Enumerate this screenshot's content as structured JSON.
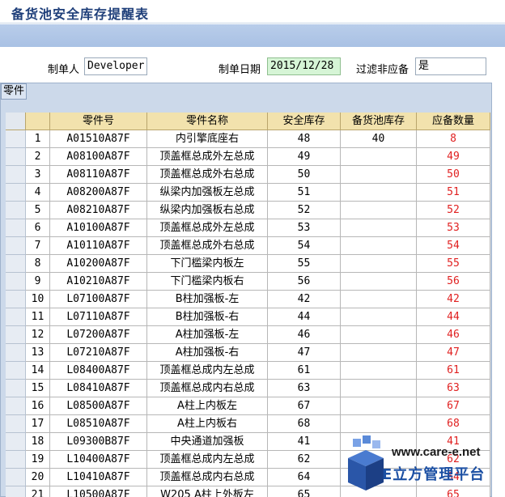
{
  "window": {
    "title": "备货池安全库存提醒表"
  },
  "filters": {
    "maker_label": "制单人",
    "maker_value": "Developer",
    "date_label": "制单日期",
    "date_value": "2015/12/28",
    "filter_label": "过滤非应备",
    "filter_value": "是"
  },
  "panel": {
    "tag": "零件"
  },
  "table": {
    "headers": [
      "零件号",
      "零件名称",
      "安全库存",
      "备货池库存",
      "应备数量"
    ],
    "rows": [
      {
        "no": "1",
        "part": "A01510A87F",
        "name": "内引擎底座右",
        "safe": "48",
        "pool": "40",
        "need": "8"
      },
      {
        "no": "2",
        "part": "A08100A87F",
        "name": "顶盖框总成外左总成",
        "safe": "49",
        "pool": "",
        "need": "49"
      },
      {
        "no": "3",
        "part": "A08110A87F",
        "name": "顶盖框总成外右总成",
        "safe": "50",
        "pool": "",
        "need": "50"
      },
      {
        "no": "4",
        "part": "A08200A87F",
        "name": "纵梁内加强板左总成",
        "safe": "51",
        "pool": "",
        "need": "51"
      },
      {
        "no": "5",
        "part": "A08210A87F",
        "name": "纵梁内加强板右总成",
        "safe": "52",
        "pool": "",
        "need": "52"
      },
      {
        "no": "6",
        "part": "A10100A87F",
        "name": "顶盖框总成外左总成",
        "safe": "53",
        "pool": "",
        "need": "53"
      },
      {
        "no": "7",
        "part": "A10110A87F",
        "name": "顶盖框总成外右总成",
        "safe": "54",
        "pool": "",
        "need": "54"
      },
      {
        "no": "8",
        "part": "A10200A87F",
        "name": "下门槛梁内板左",
        "safe": "55",
        "pool": "",
        "need": "55"
      },
      {
        "no": "9",
        "part": "A10210A87F",
        "name": "下门槛梁内板右",
        "safe": "56",
        "pool": "",
        "need": "56"
      },
      {
        "no": "10",
        "part": "L07100A87F",
        "name": "B柱加强板-左",
        "safe": "42",
        "pool": "",
        "need": "42"
      },
      {
        "no": "11",
        "part": "L07110A87F",
        "name": "B柱加强板-右",
        "safe": "44",
        "pool": "",
        "need": "44"
      },
      {
        "no": "12",
        "part": "L07200A87F",
        "name": "A柱加强板-左",
        "safe": "46",
        "pool": "",
        "need": "46"
      },
      {
        "no": "13",
        "part": "L07210A87F",
        "name": "A柱加强板-右",
        "safe": "47",
        "pool": "",
        "need": "47"
      },
      {
        "no": "14",
        "part": "L08400A87F",
        "name": "顶盖框总成内左总成",
        "safe": "61",
        "pool": "",
        "need": "61"
      },
      {
        "no": "15",
        "part": "L08410A87F",
        "name": "顶盖框总成内右总成",
        "safe": "63",
        "pool": "",
        "need": "63"
      },
      {
        "no": "16",
        "part": "L08500A87F",
        "name": "A柱上内板左",
        "safe": "67",
        "pool": "",
        "need": "67"
      },
      {
        "no": "17",
        "part": "L08510A87F",
        "name": "A柱上内板右",
        "safe": "68",
        "pool": "",
        "need": "68"
      },
      {
        "no": "18",
        "part": "L09300B87F",
        "name": "中央通道加强板",
        "safe": "41",
        "pool": "",
        "need": "41"
      },
      {
        "no": "19",
        "part": "L10400A87F",
        "name": "顶盖框总成内左总成",
        "safe": "62",
        "pool": "",
        "need": "62"
      },
      {
        "no": "20",
        "part": "L10410A87F",
        "name": "顶盖框总成内右总成",
        "safe": "64",
        "pool": "",
        "need": "64"
      },
      {
        "no": "21",
        "part": "L10500A87F",
        "name": "W205 A柱上外板左",
        "safe": "65",
        "pool": "",
        "need": "65"
      }
    ]
  },
  "watermark": {
    "url": "www.care-e.net",
    "brand": "E立方管理平台"
  }
}
